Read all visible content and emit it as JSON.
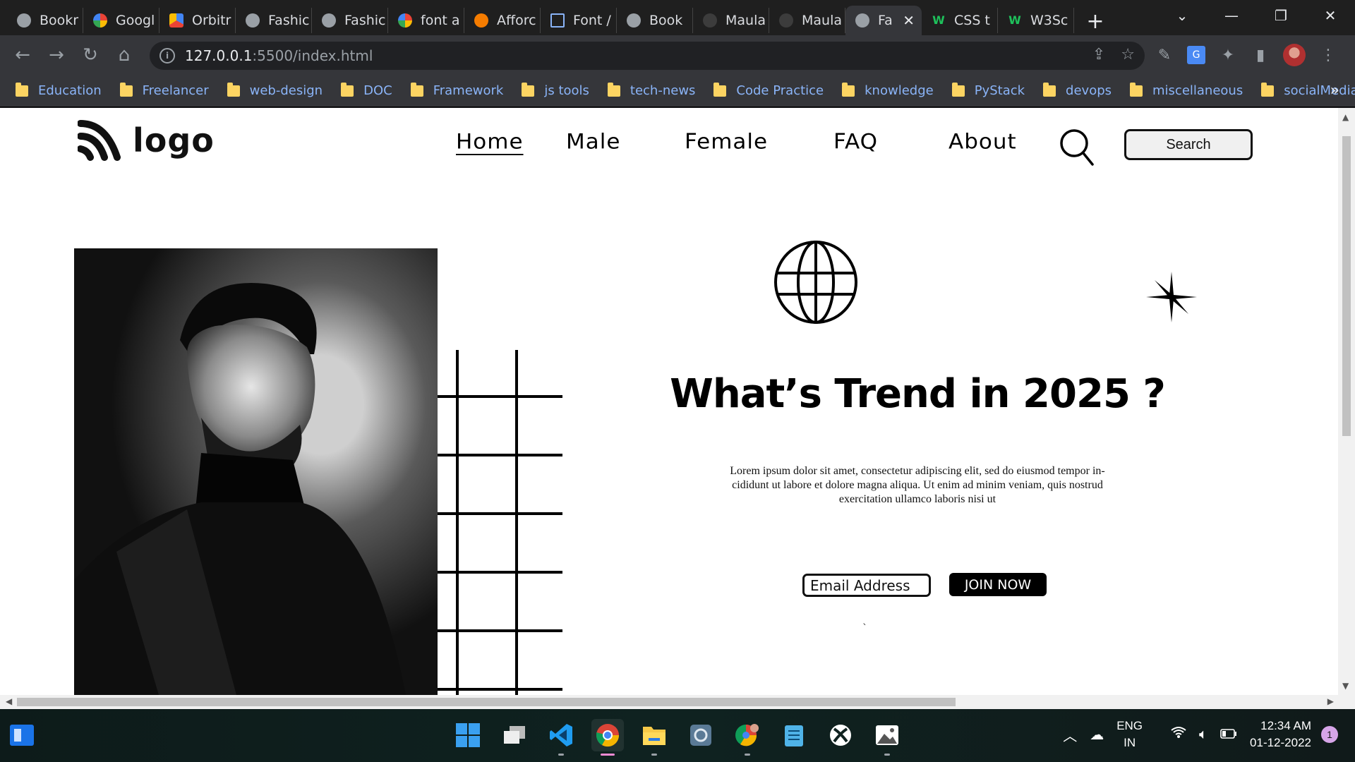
{
  "browser": {
    "tabs": [
      {
        "title": "Bookr",
        "icon": "globe-icon"
      },
      {
        "title": "Googl",
        "icon": "google-meet-icon"
      },
      {
        "title": "Orbitr",
        "icon": "orbit-icon"
      },
      {
        "title": "Fashic",
        "icon": "globe-icon"
      },
      {
        "title": "Fashic",
        "icon": "globe-icon"
      },
      {
        "title": "font a",
        "icon": "google-icon"
      },
      {
        "title": "Afforc",
        "icon": "orange-circle-icon"
      },
      {
        "title": "Font /",
        "icon": "flag-icon"
      },
      {
        "title": "Book",
        "icon": "globe-icon"
      },
      {
        "title": "Maula",
        "icon": "dark-icon"
      },
      {
        "title": "Maula",
        "icon": "dark-icon"
      },
      {
        "title": "Fa",
        "icon": "globe-icon",
        "active": true
      },
      {
        "title": "CSS t",
        "icon": "w3schools-icon"
      },
      {
        "title": "W3Sc",
        "icon": "w3schools-icon"
      }
    ],
    "new_tab_symbol": "+",
    "url_host": "127.0.0.1",
    "url_rest": ":5500/index.html",
    "bookmarks": [
      "Education",
      "Freelancer",
      "web-design",
      "DOC",
      "Framework",
      "js tools",
      "tech-news",
      "Code Practice",
      "knowledge",
      "PyStack",
      "devops",
      "miscellaneous",
      "socialMedia"
    ],
    "bookmarks_more": "»"
  },
  "site": {
    "logo_text": "logo",
    "nav": [
      "Home",
      "Male",
      "Female",
      "FAQ",
      "About"
    ],
    "search_button": "Search",
    "hero_title": "What’s Trend in 2025 ?",
    "hero_text": "Lorem ipsum dolor sit amet, consectetur adipiscing elit, sed do eiusmod tempor in-cididunt ut labore et dolore magna aliqua. Ut enim ad minim veniam, quis nostrud exercitation ullamco laboris nisi ut",
    "email_placeholder": "Email Address",
    "join_button": "JOIN NOW",
    "stray_mark": "`"
  },
  "taskbar": {
    "apps": [
      "windows-start-icon",
      "task-view-icon",
      "vscode-icon",
      "chrome-icon",
      "file-explorer-icon",
      "screen-capture-icon",
      "chrome-profile-icon",
      "notepad-icon",
      "xbox-icon",
      "photos-icon"
    ],
    "language": "ENG",
    "region": "IN",
    "time": "12:34 AM",
    "date": "01-12-2022",
    "notification_count": "1"
  },
  "colors": {
    "chrome_dark": "#202124",
    "chrome_toolbar": "#35363a",
    "link_blue": "#8ab4f8",
    "folder_yellow": "#fcd462",
    "page_bg": "#ffffff",
    "ink": "#000000"
  }
}
